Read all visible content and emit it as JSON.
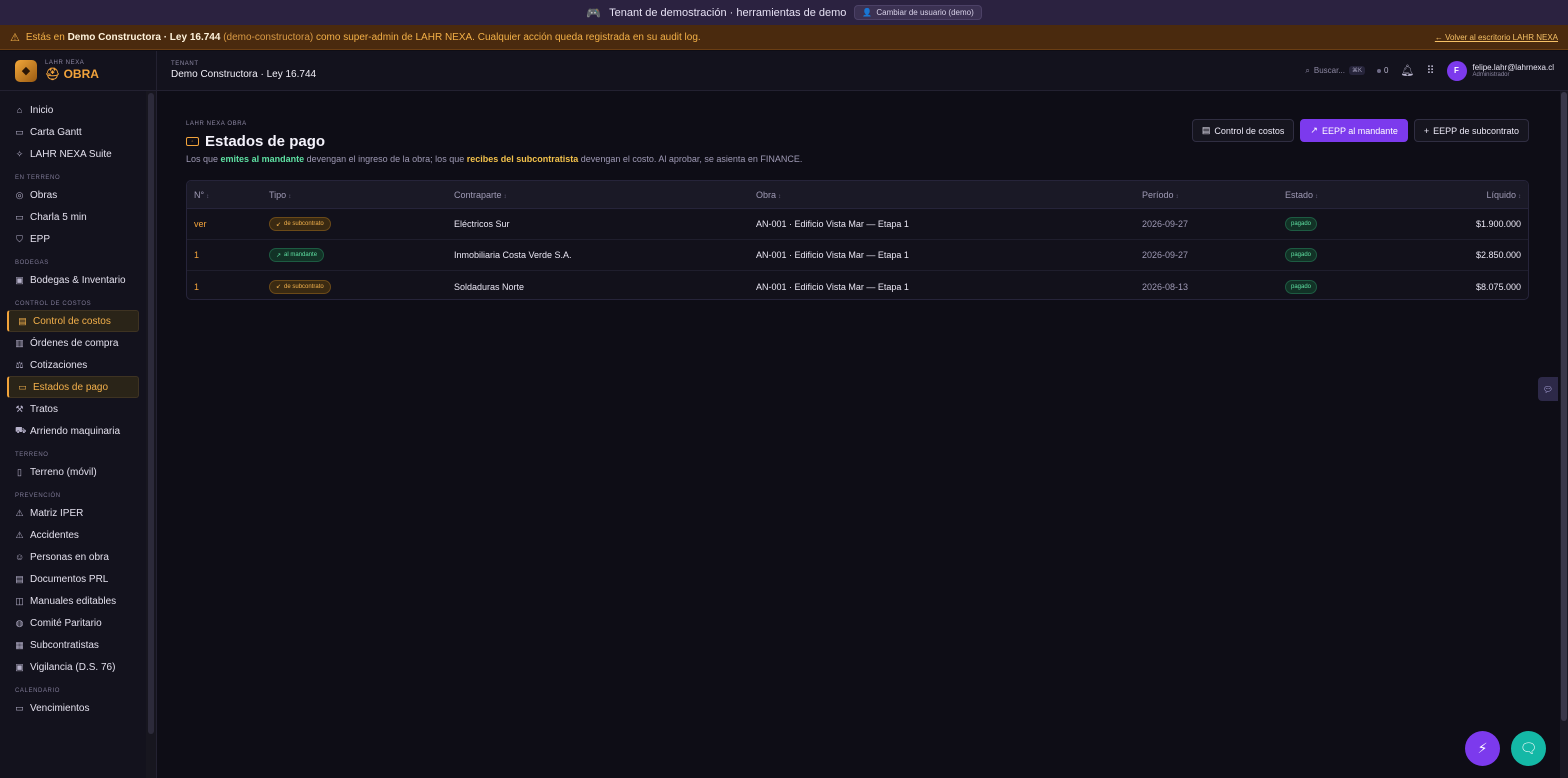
{
  "demo_bar": {
    "icon": "gamepad-icon",
    "text": "Tenant de demostración · herramientas de demo",
    "switch_label": "Cambiar de usuario (demo)"
  },
  "warning_bar": {
    "prefix": "Estás en",
    "tenant": "Demo Constructora · Ley 16.744",
    "slug": "(demo-constructora)",
    "suffix": "como super-admin de LAHR NEXA. Cualquier acción queda registrada en su audit log.",
    "back_link": "← Volver al escritorio LAHR NEXA"
  },
  "brand": {
    "small": "LAHR NEXA",
    "big": "OBRA"
  },
  "header": {
    "tenant_label": "TENANT",
    "tenant_name": "Demo Constructora · Ley 16.744",
    "search_placeholder": "Buscar...",
    "search_kbd": "⌘K",
    "status_count": "0",
    "user_initial": "F",
    "user_email": "felipe.lahr@lahrnexa.cl",
    "user_role": "Administrador"
  },
  "sidebar": {
    "items_top": [
      {
        "label": "Inicio",
        "icon": "home-icon"
      },
      {
        "label": "Carta Gantt",
        "icon": "calendar-icon"
      },
      {
        "label": "LAHR NEXA Suite",
        "icon": "sparkle-icon"
      }
    ],
    "sections": [
      {
        "title": "EN TERRENO",
        "items": [
          {
            "label": "Obras",
            "icon": "map-pin-icon"
          },
          {
            "label": "Charla 5 min",
            "icon": "calendar-icon"
          },
          {
            "label": "EPP",
            "icon": "shield-icon"
          }
        ]
      },
      {
        "title": "BODEGAS",
        "items": [
          {
            "label": "Bodegas & Inventario",
            "icon": "box-icon"
          }
        ]
      },
      {
        "title": "CONTROL DE COSTOS",
        "items": [
          {
            "label": "Control de costos",
            "icon": "wallet-icon"
          },
          {
            "label": "Órdenes de compra",
            "icon": "receipt-icon"
          },
          {
            "label": "Cotizaciones",
            "icon": "scale-icon"
          },
          {
            "label": "Estados de pago",
            "icon": "banknote-icon"
          },
          {
            "label": "Tratos",
            "icon": "hammer-icon"
          },
          {
            "label": "Arriendo maquinaria",
            "icon": "truck-icon"
          }
        ]
      },
      {
        "title": "TERRENO",
        "items": [
          {
            "label": "Terreno (móvil)",
            "icon": "phone-icon"
          }
        ]
      },
      {
        "title": "PREVENCIÓN",
        "items": [
          {
            "label": "Matriz IPER",
            "icon": "warning-icon"
          },
          {
            "label": "Accidentes",
            "icon": "warning-icon"
          },
          {
            "label": "Personas en obra",
            "icon": "users-icon"
          },
          {
            "label": "Documentos PRL",
            "icon": "document-icon"
          },
          {
            "label": "Manuales editables",
            "icon": "book-icon"
          },
          {
            "label": "Comité Paritario",
            "icon": "committee-icon"
          },
          {
            "label": "Subcontratistas",
            "icon": "building-icon"
          },
          {
            "label": "Vigilancia (D.S. 76)",
            "icon": "clipboard-icon"
          }
        ]
      },
      {
        "title": "CALENDARIO",
        "items": [
          {
            "label": "Vencimientos",
            "icon": "calendar-icon"
          }
        ]
      }
    ]
  },
  "page": {
    "eyebrow": "LAHR NEXA OBRA",
    "title": "Estados de pago",
    "subtitle_1": "Los que",
    "subtitle_hl1": "emites al mandante",
    "subtitle_2": "devengan el ingreso de la obra; los que",
    "subtitle_hl2": "recibes del subcontratista",
    "subtitle_3": "devengan el costo. Al aprobar, se asienta en FINANCE."
  },
  "actions": {
    "cost_control": "Control de costos",
    "eepp_mandante": "EEPP al mandante",
    "eepp_sub": "EEPP de subcontrato"
  },
  "table": {
    "headers": [
      "N°",
      "Tipo",
      "Contraparte",
      "Obra",
      "Período",
      "Estado",
      "Líquido"
    ],
    "rows": [
      {
        "num": "ver",
        "tipo": "de subcontrato",
        "tipo_kind": "sub",
        "contraparte": "Eléctricos Sur",
        "obra": "AN-001 · Edificio Vista Mar — Etapa 1",
        "periodo": "2026-09-27",
        "estado": "pagado",
        "liquido": "$1.900.000"
      },
      {
        "num": "1",
        "tipo": "al mandante",
        "tipo_kind": "man",
        "contraparte": "Inmobiliaria Costa Verde S.A.",
        "obra": "AN-001 · Edificio Vista Mar — Etapa 1",
        "periodo": "2026-09-27",
        "estado": "pagado",
        "liquido": "$2.850.000"
      },
      {
        "num": "1",
        "tipo": "de subcontrato",
        "tipo_kind": "sub",
        "contraparte": "Soldaduras Norte",
        "obra": "AN-001 · Edificio Vista Mar — Etapa 1",
        "periodo": "2026-08-13",
        "estado": "pagado",
        "liquido": "$8.075.000"
      }
    ]
  },
  "colors": {
    "accent": "#f2a33b",
    "primary": "#7c3aed",
    "success": "#5ee0a2",
    "teal": "#14b8a6"
  }
}
